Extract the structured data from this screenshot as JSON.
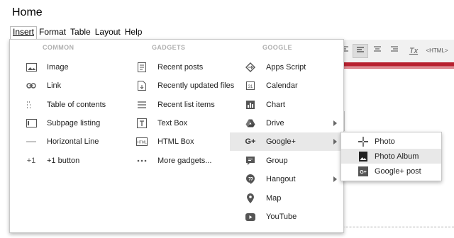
{
  "page": {
    "title": "Home"
  },
  "menubar": {
    "insert": "Insert",
    "format": "Format",
    "table": "Table",
    "layout": "Layout",
    "help": "Help"
  },
  "toolbar": {
    "clear_format_label": "Tx",
    "html_label": "<HTML>"
  },
  "insert_menu": {
    "headers": {
      "common": "COMMON",
      "gadgets": "GADGETS",
      "google": "GOOGLE"
    },
    "common": {
      "image": "Image",
      "link": "Link",
      "toc": "Table of contents",
      "subpage": "Subpage listing",
      "hr": "Horizontal Line",
      "plusone": "+1 button"
    },
    "gadgets": {
      "recent_posts": "Recent posts",
      "recent_files": "Recently updated files",
      "recent_list": "Recent list items",
      "text_box": "Text Box",
      "html_box": "HTML Box",
      "more": "More gadgets..."
    },
    "google": {
      "apps_script": "Apps Script",
      "calendar": "Calendar",
      "chart": "Chart",
      "drive": "Drive",
      "googleplus": "Google+",
      "group": "Group",
      "hangout": "Hangout",
      "map": "Map",
      "youtube": "YouTube"
    }
  },
  "googleplus_submenu": {
    "photo": "Photo",
    "photo_album": "Photo Album",
    "post": "Google+ post"
  },
  "colors": {
    "accent_stripe": "#b8202f",
    "hover": "#e8e8e8",
    "header_text": "#b0b0b0"
  }
}
